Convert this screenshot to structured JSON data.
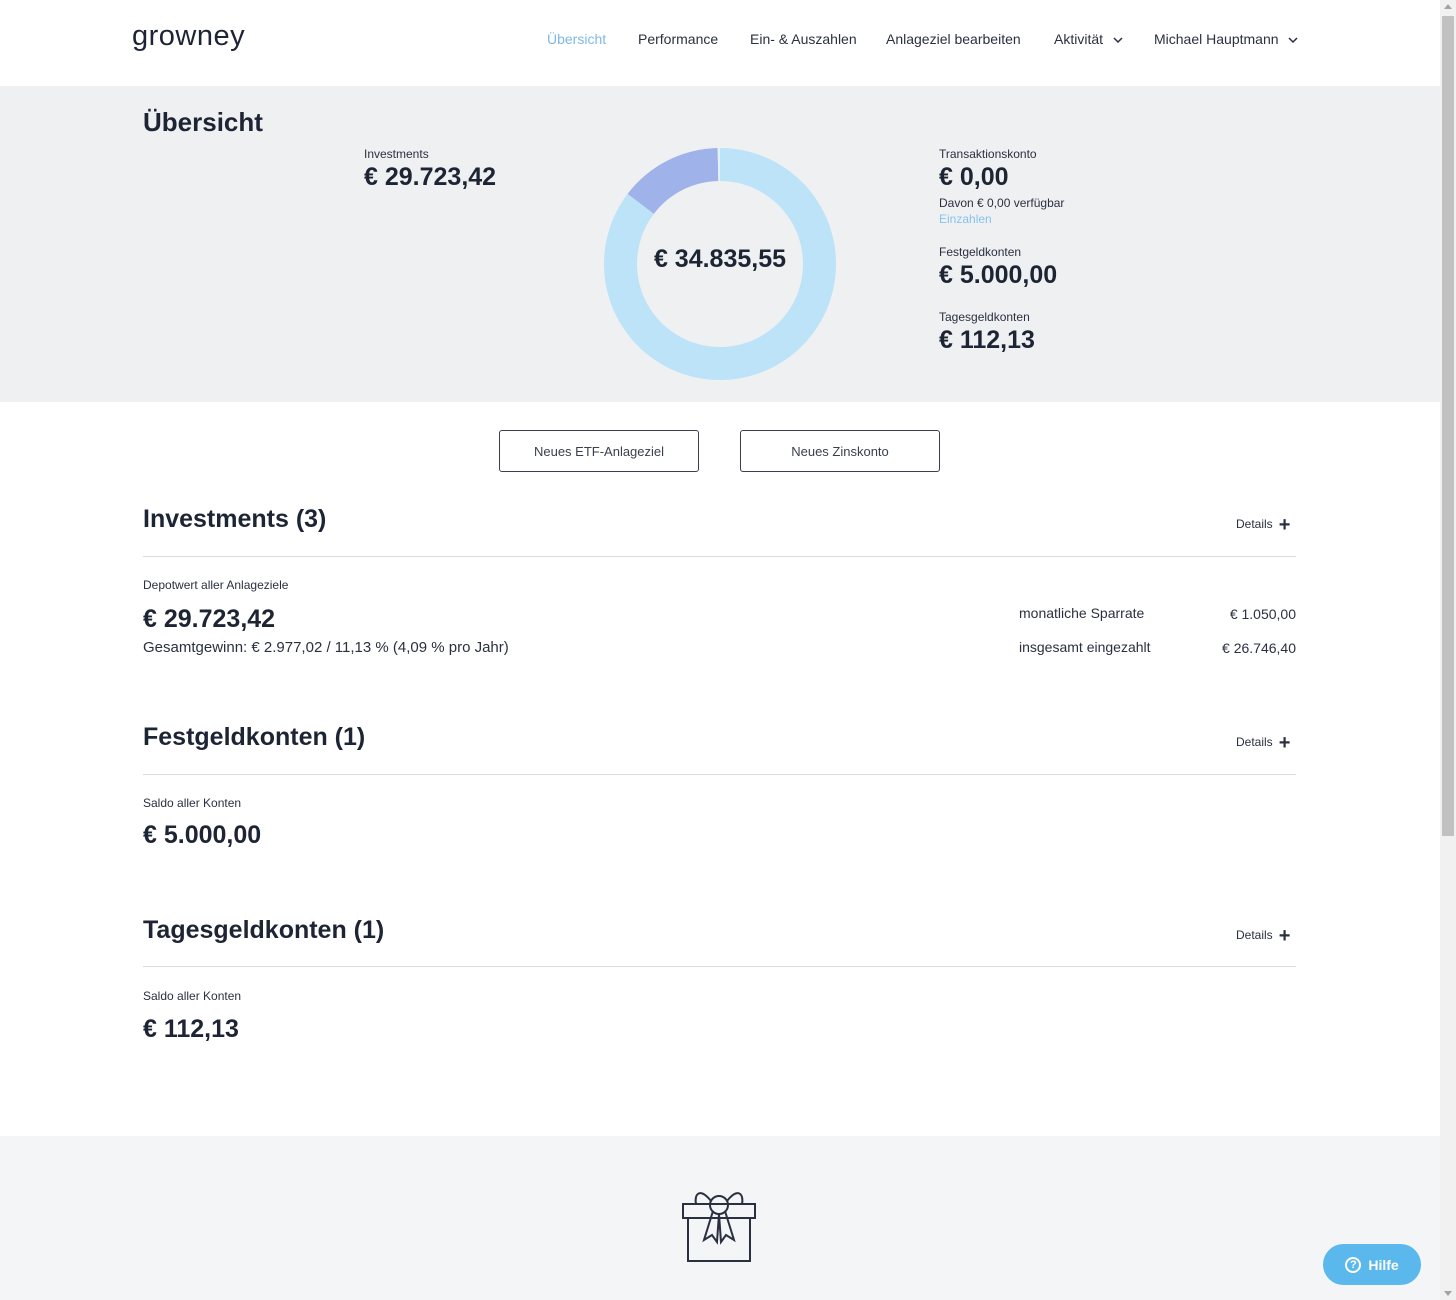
{
  "brand": {
    "logo": "growney"
  },
  "nav": {
    "items": [
      {
        "label": "Übersicht",
        "active": true
      },
      {
        "label": "Performance"
      },
      {
        "label": "Ein- & Auszahlen"
      },
      {
        "label": "Anlageziel bearbeiten"
      },
      {
        "label": "Aktivität",
        "dropdown": true
      },
      {
        "label": "Michael Hauptmann",
        "dropdown": true
      }
    ]
  },
  "summary": {
    "title": "Übersicht",
    "investments": {
      "label": "Investments",
      "amount": "€ 29.723,42"
    },
    "total": "€ 34.835,55",
    "transaction": {
      "label": "Transaktionskonto",
      "amount": "€ 0,00",
      "available": "Davon € 0,00 verfügbar",
      "link": "Einzahlen"
    },
    "fixed": {
      "label": "Festgeldkonten",
      "amount": "€ 5.000,00"
    },
    "daily": {
      "label": "Tagesgeldkonten",
      "amount": "€ 112,13"
    }
  },
  "chart_data": {
    "type": "pie",
    "categories": [
      "Investments",
      "Festgeldkonten",
      "Tagesgeldkonten"
    ],
    "values": [
      29723.42,
      5000.0,
      112.13
    ],
    "colors": [
      "#bde3f9",
      "#9fb2ea",
      "#e3f2fc"
    ],
    "center_label": "€ 34.835,55"
  },
  "actions": {
    "new_etf": "Neues ETF-Anlageziel",
    "new_interest": "Neues Zinskonto"
  },
  "investments_section": {
    "title": "Investments (3)",
    "details": "Details",
    "sublabel": "Depotwert aller Anlageziele",
    "amount": "€ 29.723,42",
    "gain": "Gesamtgewinn: € 2.977,02 / 11,13 % (4,09 % pro Jahr)",
    "stats": [
      {
        "label": "monatliche Sparrate",
        "value": "€ 1.050,00"
      },
      {
        "label": "insgesamt eingezahlt",
        "value": "€ 26.746,40"
      }
    ]
  },
  "fixed_section": {
    "title": "Festgeldkonten (1)",
    "details": "Details",
    "sublabel": "Saldo aller Konten",
    "amount": "€ 5.000,00"
  },
  "daily_section": {
    "title": "Tagesgeldkonten (1)",
    "details": "Details",
    "sublabel": "Saldo aller Konten",
    "amount": "€ 112,13"
  },
  "help": {
    "label": "Hilfe"
  }
}
